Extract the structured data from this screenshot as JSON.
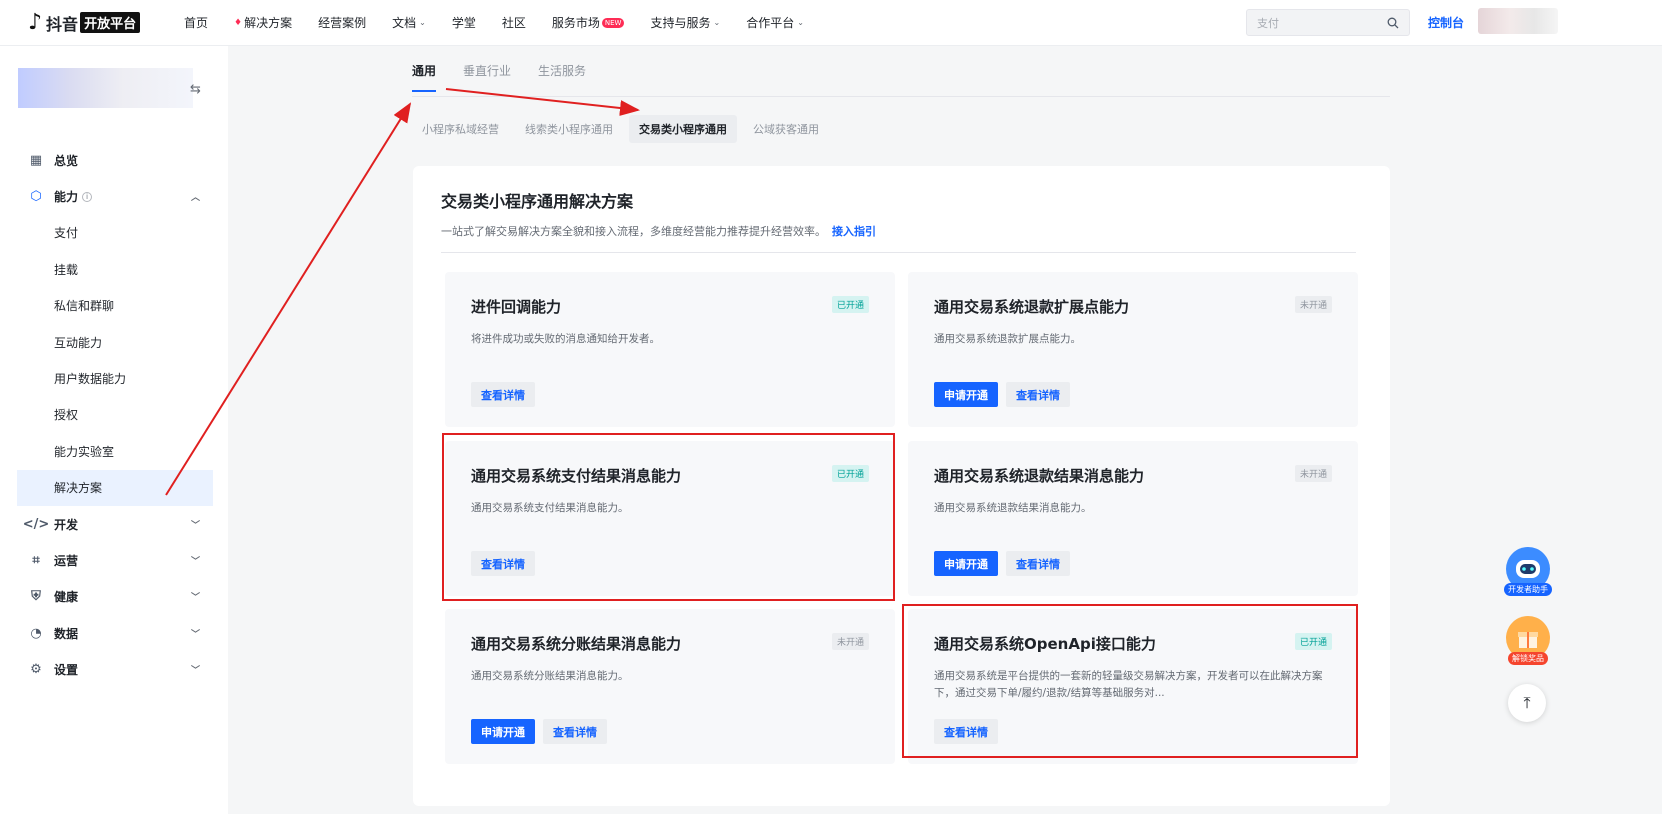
{
  "topnav": {
    "logo_text": "抖音",
    "logo_box": "开放平台",
    "items": [
      {
        "label": "首页"
      },
      {
        "label": "解决方案"
      },
      {
        "label": "经营案例"
      },
      {
        "label": "文档"
      },
      {
        "label": "学堂"
      },
      {
        "label": "社区"
      },
      {
        "label": "服务市场"
      },
      {
        "label": "支持与服务"
      },
      {
        "label": "合作平台"
      }
    ],
    "new_badge": "NEW",
    "search_value": "支付",
    "console_label": "控制台"
  },
  "sidebar": {
    "menu": [
      {
        "label": "总览"
      },
      {
        "label": "能力"
      },
      {
        "label": "支付"
      },
      {
        "label": "挂载"
      },
      {
        "label": "私信和群聊"
      },
      {
        "label": "互动能力"
      },
      {
        "label": "用户数据能力"
      },
      {
        "label": "授权"
      },
      {
        "label": "能力实验室"
      },
      {
        "label": "解决方案"
      },
      {
        "label": "开发"
      },
      {
        "label": "运营"
      },
      {
        "label": "健康"
      },
      {
        "label": "数据"
      },
      {
        "label": "设置"
      }
    ]
  },
  "main": {
    "tabs": [
      {
        "label": "通用"
      },
      {
        "label": "垂直行业"
      },
      {
        "label": "生活服务"
      }
    ],
    "subtabs": [
      {
        "label": "小程序私域经营"
      },
      {
        "label": "线索类小程序通用"
      },
      {
        "label": "交易类小程序通用"
      },
      {
        "label": "公域获客通用"
      }
    ],
    "panel_title": "交易类小程序通用解决方案",
    "panel_desc": "一站式了解交易解决方案全貌和接入流程，多维度经营能力推荐提升经营效率。",
    "panel_link": "接入指引",
    "cards": [
      {
        "title": "进件回调能力",
        "status": "已开通",
        "desc": "将进件成功或失败的消息通知给开发者。",
        "apply": "",
        "detail": "查看详情"
      },
      {
        "title": "通用交易系统退款扩展点能力",
        "status": "未开通",
        "desc": "通用交易系统退款扩展点能力。",
        "apply": "申请开通",
        "detail": "查看详情"
      },
      {
        "title": "通用交易系统支付结果消息能力",
        "status": "已开通",
        "desc": "通用交易系统支付结果消息能力。",
        "apply": "",
        "detail": "查看详情"
      },
      {
        "title": "通用交易系统退款结果消息能力",
        "status": "未开通",
        "desc": "通用交易系统退款结果消息能力。",
        "apply": "申请开通",
        "detail": "查看详情"
      },
      {
        "title": "通用交易系统分账结果消息能力",
        "status": "未开通",
        "desc": "通用交易系统分账结果消息能力。",
        "apply": "申请开通",
        "detail": "查看详情"
      },
      {
        "title": "通用交易系统OpenApi接口能力",
        "status": "已开通",
        "desc": "通用交易系统是平台提供的一套新的轻量级交易解决方案，开发者可以在此解决方案下，通过交易下单/履约/退款/结算等基础服务对...",
        "apply": "",
        "detail": "查看详情"
      }
    ]
  },
  "floats": {
    "assistant_label": "开发者助手",
    "reward_label": "解锁奖品"
  },
  "colors": {
    "accent": "#1664ff",
    "annotation_red": "#e02020",
    "status_on": "#00a196"
  }
}
